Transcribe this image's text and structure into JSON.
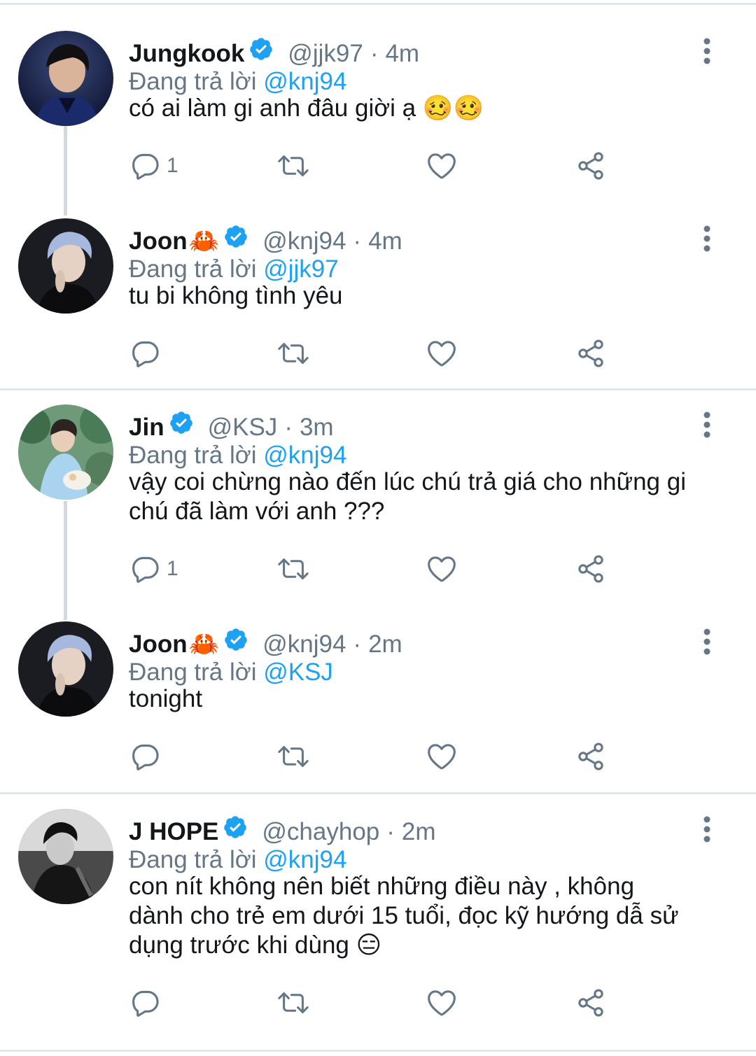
{
  "tweets": [
    {
      "name": "Jungkook",
      "name_emoji": "",
      "handle": "@jjk97",
      "dot": "·",
      "time": "4m",
      "replying_label": "Đang trả lời",
      "replying_to": "@knj94",
      "text_lines": [
        "có ai làm gi anh đâu giời ạ 🥴🥴"
      ],
      "reply_count": "1",
      "avatar_style": "color-dark-blue"
    },
    {
      "name": "Joon",
      "name_emoji": "🦀",
      "handle": "@knj94",
      "dot": "·",
      "time": "4m",
      "replying_label": "Đang trả lời",
      "replying_to": "@jjk97",
      "text_lines": [
        "tu bi không tình yêu"
      ],
      "reply_count": "",
      "avatar_style": "dark-silver-hair"
    },
    {
      "name": "Jin",
      "name_emoji": "",
      "handle": "@KSJ",
      "dot": "·",
      "time": "3m",
      "replying_label": "Đang trả lời",
      "replying_to": "@knj94",
      "text_lines": [
        "vậy coi chừng nào đến lúc chú trả giá cho những gi",
        "chú đã làm với anh ???"
      ],
      "reply_count": "1",
      "avatar_style": "outdoor-green"
    },
    {
      "name": "Joon",
      "name_emoji": "🦀",
      "handle": "@knj94",
      "dot": "·",
      "time": "2m",
      "replying_label": "Đang trả lời",
      "replying_to": "@KSJ",
      "text_lines": [
        "tonight"
      ],
      "reply_count": "",
      "avatar_style": "dark-silver-hair"
    },
    {
      "name": "J HOPE",
      "name_emoji": "",
      "handle": "@chayhop",
      "dot": "·",
      "time": "2m",
      "replying_label": "Đang trả lời",
      "replying_to": "@knj94",
      "text_lines": [
        "con nít không nên biết những điều này , không",
        "dành cho trẻ em dưới 15 tuổi, đọc kỹ hướng dẫ sử",
        "dụng trước khi dùng 😑"
      ],
      "reply_count": "",
      "avatar_style": "monochrome"
    }
  ],
  "icons": {
    "reply": "reply-icon",
    "retweet": "retweet-icon",
    "like": "like-icon",
    "share": "share-icon",
    "verified": "verified-badge-icon",
    "menu": "more-options-icon"
  },
  "colors": {
    "accent": "#1da1f2",
    "secondary_text": "#657786",
    "primary_text": "#14171a",
    "divider": "#e1e8ed"
  }
}
